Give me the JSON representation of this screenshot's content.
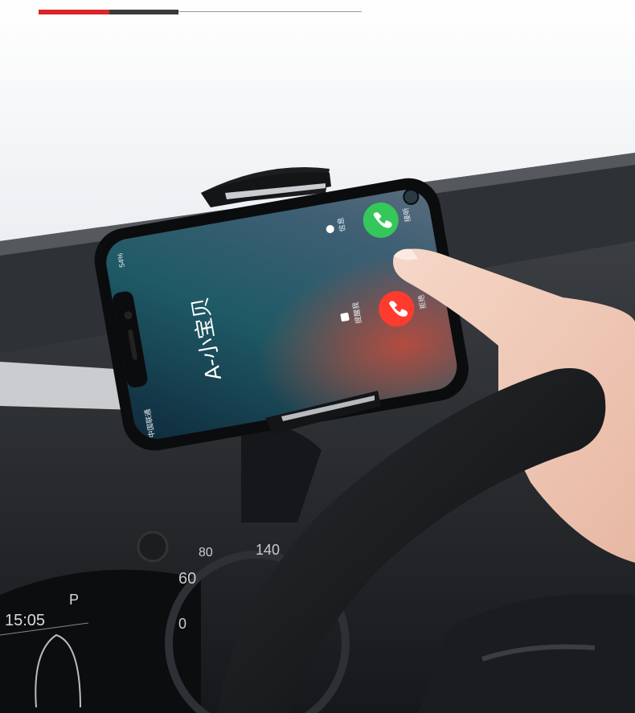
{
  "header_bar": {
    "accent_color": "#d9252b",
    "dark_color": "#3a3a3a",
    "line_color": "#9a9a9a"
  },
  "phone": {
    "status_battery": "54%",
    "status_carrier": "中国联通",
    "caller_name": "A-小宝贝",
    "message_label": "信息",
    "accept_label": "接听",
    "remind_label": "提醒我",
    "decline_label": "拒绝",
    "accept_color": "#35c759",
    "decline_color": "#ff3b30"
  },
  "dashboard": {
    "clock": "15:05",
    "gear": "P",
    "speed_140": "140",
    "speed_80": "80",
    "speed_60": "60",
    "speed_0": "0"
  }
}
